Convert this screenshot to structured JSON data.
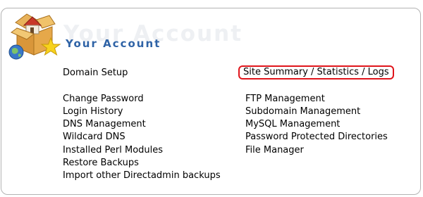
{
  "header": {
    "title": "Your Account",
    "watermark": "Your Account",
    "logo_icon": "house-box-globe-star-icon"
  },
  "links": {
    "domain_setup": "Domain Setup",
    "site_summary": "Site Summary / Statistics / Logs",
    "change_password": "Change Password",
    "login_history": "Login History",
    "dns_management": "DNS Management",
    "wildcard_dns": "Wildcard DNS",
    "installed_perl_modules": "Installed Perl Modules",
    "restore_backups": "Restore Backups",
    "import_backups": "Import other Directadmin backups",
    "ftp_management": "FTP Management",
    "subdomain_management": "Subdomain Management",
    "mysql_management": "MySQL Management",
    "password_protected_directories": "Password Protected Directories",
    "file_manager": "File Manager"
  },
  "colors": {
    "title": "#2f63a6",
    "highlight_border": "#e0151b",
    "panel_border": "#b3b3b3"
  }
}
